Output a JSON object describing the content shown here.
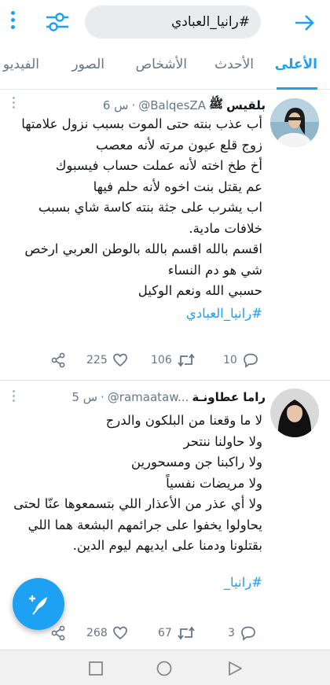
{
  "search": {
    "query": "#رانيا_العبادي"
  },
  "tabs": [
    {
      "label": "الأعلى"
    },
    {
      "label": "الأحدث"
    },
    {
      "label": "الأشخاص"
    },
    {
      "label": "الصور"
    },
    {
      "label": "الفيديو"
    }
  ],
  "tweets": [
    {
      "name": "بلقيس",
      "name_suffix": "ﷺ",
      "handle": "@BalqesZA",
      "time": "6 س",
      "lines": [
        "أب عذب بنته حتى الموت بسبب نزول علامتها",
        "زوج قلع عيون مرته لأنه معصب",
        "أخ طخ اخته لأنه عملت حساب فيسبوك",
        "عم يقتل بنت اخوه لأنه حلم فيها",
        " اب يشرب على جثة بنته كاسة شاي بسبب خلافات مادية.",
        "اقسم بالله اقسم بالله بالوطن العربي ارخص شي هو دم النساء",
        "حسبي الله ونعم الوكيل"
      ],
      "hashtag": "#رانيا_العبادي",
      "replies": "10",
      "retweets": "106",
      "likes": "225"
    },
    {
      "name": "راما عطاونـة",
      "handle": "@ramaataw...",
      "time": "5 س",
      "lines": [
        "لا ما وقعنا من البلكون والدرج",
        "ولا حاولنا ننتحر",
        "ولا راكبنا جن ومسحورين",
        "ولا مريضات نفسياً",
        "ولا أي عذر من الأعذار اللي بتسمعوها عنّا لحتى يحاولوا يخفوا على جرائمهم البشعة هما اللي بقتلونا ودمنا على ايديهم ليوم الدين."
      ],
      "hashtag": "#رانيا_",
      "replies": "3",
      "retweets": "67",
      "likes": "268"
    }
  ],
  "colors": {
    "accent": "#1da1f2",
    "muted": "#657786",
    "divider": "#e1e8ed"
  }
}
